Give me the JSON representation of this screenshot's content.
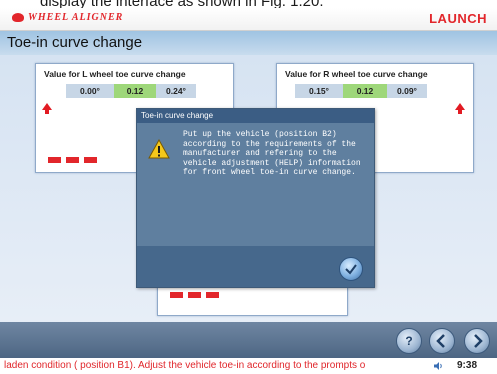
{
  "doc_caption": "display the interface as shown in Fig. 1.20.",
  "header": {
    "brand": "WHEEL ALIGNER",
    "logo": "LAUNCH",
    "brand_color": "#e2262b"
  },
  "title": "Toe-in curve change",
  "left_panel": {
    "title": "Value for L wheel toe curve change",
    "values": [
      "0.00°",
      "0.12",
      "0.24°"
    ]
  },
  "right_panel": {
    "title": "Value for R wheel toe curve change",
    "values": [
      "0.15°",
      "0.12",
      "0.09°"
    ]
  },
  "dialog": {
    "title": "Toe-in curve change",
    "icon": "warning-icon",
    "message": "Put up the vehicle (position B2) according to the requirements of the manufacturer and refering to the vehicle adjustment (HELP) information for front wheel toe-in curve change."
  },
  "toolbar": {
    "icons": [
      "help-icon",
      "back-icon",
      "next-icon"
    ]
  },
  "status": {
    "message": "laden condition ( position B1). Adjust the vehicle toe-in according to the prompts o",
    "time": "9:38"
  },
  "colors": {
    "accent_red": "#e2262b",
    "title_bar": "#b3cfe8",
    "dialog_bg": "#5f7f9f",
    "value_green": "#9ed77a"
  }
}
